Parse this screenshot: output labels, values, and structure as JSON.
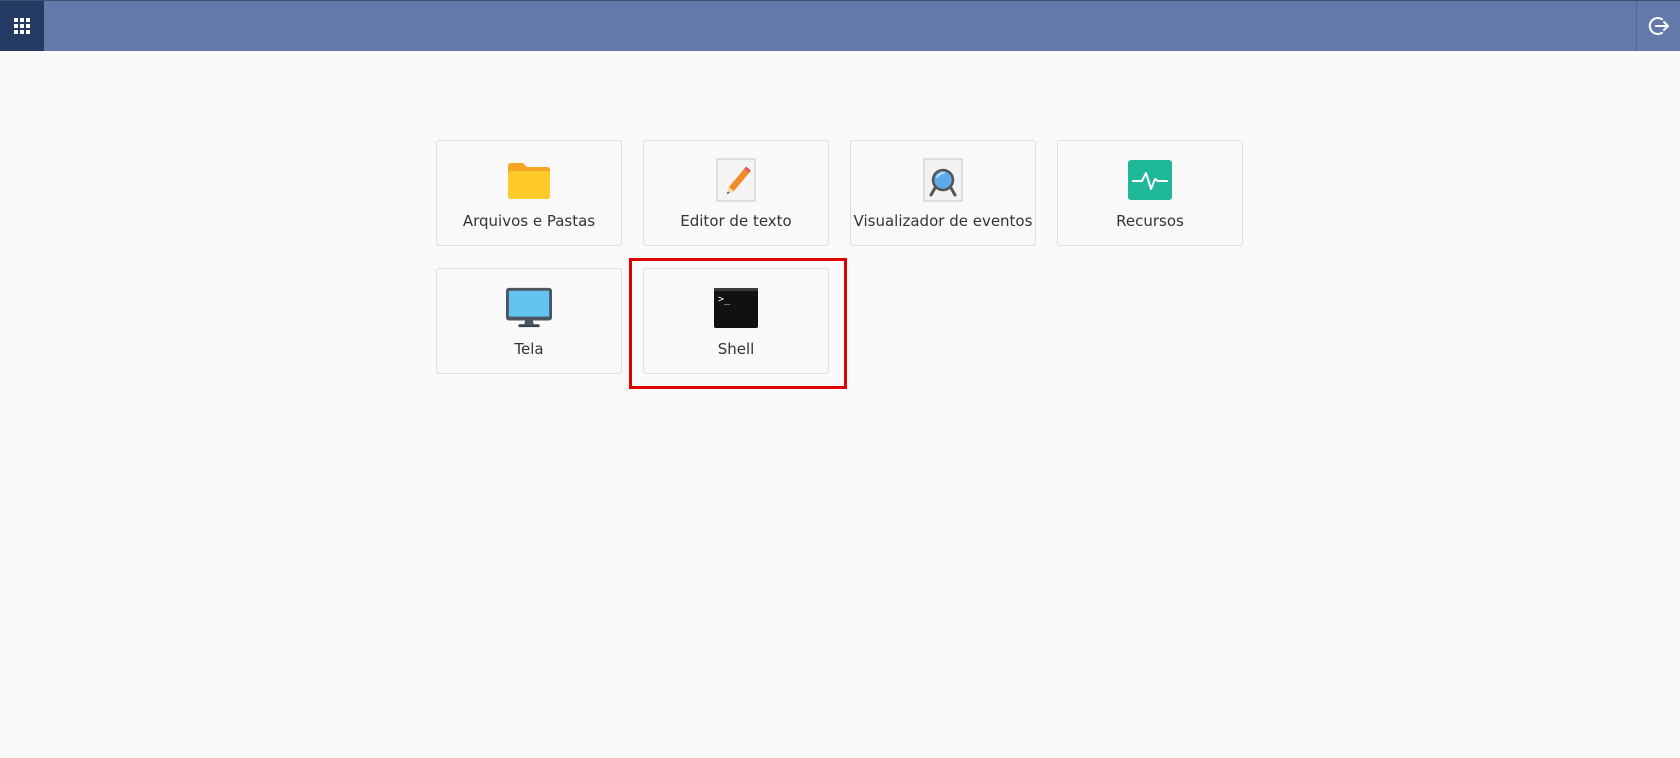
{
  "topbar": {
    "apps_icon": "grid-apps-icon",
    "logout_icon": "logout-icon",
    "color": "#6379aa",
    "apps_bg": "#243a63"
  },
  "apps": [
    {
      "label": "Arquivos e Pastas",
      "icon": "folder-icon",
      "color": "#fbbf24"
    },
    {
      "label": "Editor de texto",
      "icon": "text-editor-icon",
      "color": "#f97316"
    },
    {
      "label": "Visualizador de eventos",
      "icon": "event-viewer-icon",
      "color": "#60a5fa"
    },
    {
      "label": "Recursos",
      "icon": "resources-icon",
      "color": "#1fb99a"
    },
    {
      "label": "Tela",
      "icon": "monitor-icon",
      "color": "#60c4ef"
    },
    {
      "label": "Shell",
      "icon": "terminal-icon",
      "color": "#111111",
      "glyph": ">_"
    }
  ],
  "highlight": {
    "target": "Shell",
    "color": "#e00000"
  }
}
